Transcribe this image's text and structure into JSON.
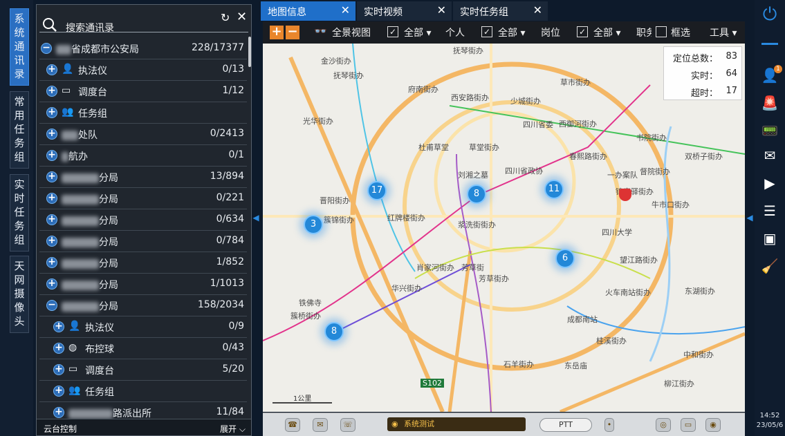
{
  "left_nav": [
    {
      "label": "系统通讯录",
      "active": true
    },
    {
      "label": "常用任务组",
      "active": false
    },
    {
      "label": "实时任务组",
      "active": false
    },
    {
      "label": "天网摄像头",
      "active": false
    }
  ],
  "contacts": {
    "search_placeholder": "搜索通讯录",
    "root": {
      "label": "省成都市公安局",
      "count": "228/17377"
    },
    "rows": [
      {
        "indent": 1,
        "icon": "person-icon",
        "label": "执法仪",
        "count": "0/13",
        "expanded": false
      },
      {
        "indent": 1,
        "icon": "console-icon",
        "label": "调度台",
        "count": "1/12",
        "expanded": false
      },
      {
        "indent": 1,
        "icon": "group-icon",
        "label": "任务组",
        "count": "",
        "expanded": false
      },
      {
        "indent": 1,
        "icon": "",
        "label": "处队",
        "count": "0/2413",
        "expanded": false,
        "blur": 24
      },
      {
        "indent": 1,
        "icon": "",
        "label": "航办",
        "count": "0/1",
        "expanded": false,
        "blur": 10
      },
      {
        "indent": 1,
        "icon": "",
        "label": "分局",
        "count": "13/894",
        "expanded": false,
        "blur": 54
      },
      {
        "indent": 1,
        "icon": "",
        "label": "分局",
        "count": "0/221",
        "expanded": false,
        "blur": 54
      },
      {
        "indent": 1,
        "icon": "",
        "label": "分局",
        "count": "0/634",
        "expanded": false,
        "blur": 54
      },
      {
        "indent": 1,
        "icon": "",
        "label": "分局",
        "count": "0/784",
        "expanded": false,
        "blur": 54
      },
      {
        "indent": 1,
        "icon": "",
        "label": "分局",
        "count": "1/852",
        "expanded": false,
        "blur": 54
      },
      {
        "indent": 1,
        "icon": "",
        "label": "分局",
        "count": "1/1013",
        "expanded": false,
        "blur": 54
      },
      {
        "indent": 1,
        "icon": "",
        "label": "分局",
        "count": "158/2034",
        "expanded": true,
        "blur": 54
      },
      {
        "indent": 2,
        "icon": "person-icon",
        "label": "执法仪",
        "count": "0/9",
        "expanded": false
      },
      {
        "indent": 2,
        "icon": "ball-camera-icon",
        "label": "布控球",
        "count": "0/43",
        "expanded": false
      },
      {
        "indent": 2,
        "icon": "console-icon",
        "label": "调度台",
        "count": "5/20",
        "expanded": false
      },
      {
        "indent": 2,
        "icon": "group-icon",
        "label": "任务组",
        "count": "",
        "expanded": false
      },
      {
        "indent": 2,
        "icon": "",
        "label": "路派出所",
        "count": "11/84",
        "expanded": false,
        "blur": 64
      }
    ],
    "footer_left": "云台控制",
    "footer_right": "展开"
  },
  "tabs": [
    {
      "label": "地图信息",
      "active": true
    },
    {
      "label": "实时视频",
      "active": false
    },
    {
      "label": "实时任务组",
      "active": false
    }
  ],
  "map_toolbar": {
    "full_view": "全景视图",
    "filter1_value": "全部",
    "filter1_label": "个人",
    "filter2_value": "全部",
    "filter2_label": "岗位",
    "filter3_value": "全部",
    "filter3_label": "职务",
    "box_select": "框选",
    "tools": "工具"
  },
  "stats": [
    {
      "label": "定位总数：",
      "value": "83"
    },
    {
      "label": "实时：",
      "value": "64"
    },
    {
      "label": "超时：",
      "value": "17"
    }
  ],
  "clusters": [
    "17",
    "8",
    "11",
    "3",
    "6",
    "8"
  ],
  "places": [
    "抚琴街办",
    "金沙街办",
    "抚琴街办",
    "府南街办",
    "西安路街办",
    "少城街办",
    "草市街办",
    "光华街办",
    "四川省委",
    "西御河街办",
    "书院街办",
    "双桥子街办",
    "督院街办",
    "杜甫草堂",
    "草堂街办",
    "春熙路街办",
    "刘湘之墓",
    "四川省政协",
    "一办案队",
    "锦官驿街办",
    "牛市口街办",
    "晋阳街办",
    "簇锦街办",
    "红牌楼街办",
    "浆洗街街办",
    "四川大学",
    "肖家河街办",
    "芳草街",
    "望江路街办",
    "华兴街办",
    "芳草街办",
    "火车南站街办",
    "东湖街办",
    "铁佛寺",
    "簇桥街办",
    "成都南站",
    "桂溪街办",
    "石羊街办",
    "东岳庙",
    "柳江街办",
    "中和街办",
    "S102"
  ],
  "scale_label": "1公里",
  "bottom": {
    "status": "系统测试",
    "ptt": "PTT"
  },
  "right_bar": {
    "badge": "1",
    "time": "14:52",
    "date": "23/05/6"
  }
}
